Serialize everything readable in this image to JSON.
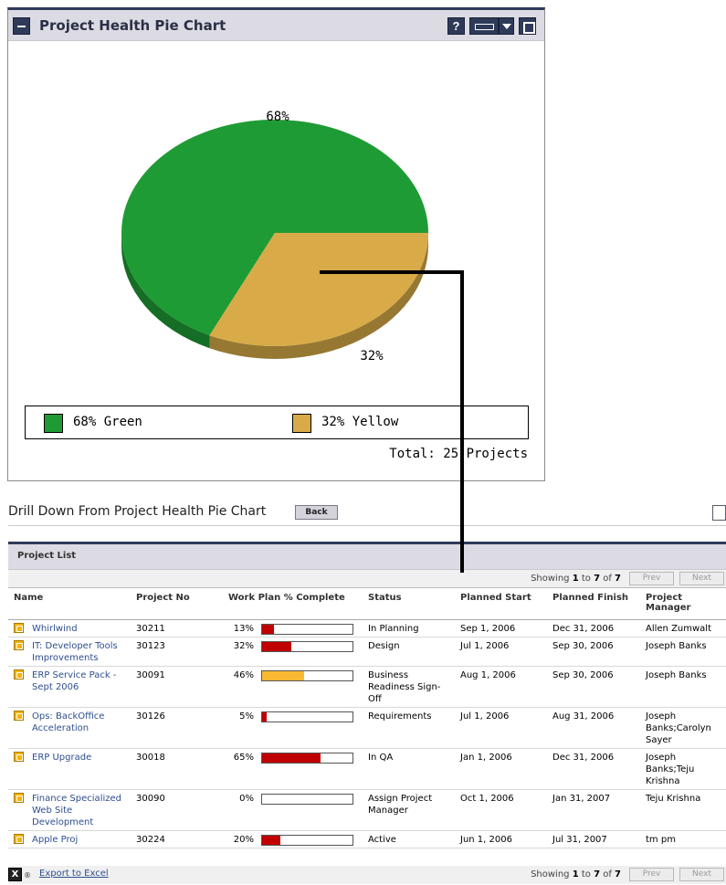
{
  "portlet": {
    "title": "Project Health Pie Chart",
    "help_label": "?"
  },
  "chart_data": {
    "type": "pie",
    "slices": [
      {
        "name": "Green",
        "value": 68,
        "label": "68%",
        "legend": "68% Green",
        "color": "#1f9b35"
      },
      {
        "name": "Yellow",
        "value": 32,
        "label": "32%",
        "legend": "32% Yellow",
        "color": "#d8ab48"
      }
    ],
    "total_text": "Total: 25 Projects"
  },
  "drill": {
    "title": "Drill Down From Project Health Pie Chart",
    "back_label": "Back"
  },
  "list": {
    "title": "Project List",
    "showing_prefix": "Showing ",
    "showing_from": "1",
    "showing_to_word": " to ",
    "showing_to": "7",
    "showing_of_word": " of ",
    "showing_total": "7",
    "prev_label": "Prev",
    "next_label": "Next",
    "export_label": "Export to Excel",
    "columns": [
      "Name",
      "Project No",
      "Work Plan % Complete",
      "Status",
      "Planned Start",
      "Planned Finish",
      "Project Manager"
    ],
    "rows": [
      {
        "name": "Whirlwind",
        "no": "30211",
        "pct": "13%",
        "pct_value": 13,
        "bar_color": "#c00000",
        "status": "In Planning",
        "start": "Sep 1, 2006",
        "finish": "Dec 31, 2006",
        "manager": "Allen Zumwalt"
      },
      {
        "name": "IT: Developer Tools Improvements",
        "no": "30123",
        "pct": "32%",
        "pct_value": 32,
        "bar_color": "#c00000",
        "status": "Design",
        "start": "Jul 1, 2006",
        "finish": "Sep 30, 2006",
        "manager": "Joseph Banks"
      },
      {
        "name": "ERP Service Pack - Sept 2006",
        "no": "30091",
        "pct": "46%",
        "pct_value": 46,
        "bar_color": "#f9b932",
        "status": "Business Readiness Sign-Off",
        "start": "Aug 1, 2006",
        "finish": "Sep 30, 2006",
        "manager": "Joseph Banks"
      },
      {
        "name": "Ops: BackOffice Acceleration",
        "no": "30126",
        "pct": "5%",
        "pct_value": 5,
        "bar_color": "#c00000",
        "status": "Requirements",
        "start": "Jul 1, 2006",
        "finish": "Aug 31, 2006",
        "manager": "Joseph Banks;Carolyn Sayer"
      },
      {
        "name": "ERP Upgrade",
        "no": "30018",
        "pct": "65%",
        "pct_value": 65,
        "bar_color": "#c00000",
        "status": "In QA",
        "start": "Jan 1, 2006",
        "finish": "Dec 31, 2006",
        "manager": "Joseph Banks;Teju Krishna"
      },
      {
        "name": "Finance Specialized Web Site Development",
        "no": "30090",
        "pct": "0%",
        "pct_value": 0,
        "bar_color": "#c00000",
        "status": "Assign Project Manager",
        "start": "Oct 1, 2006",
        "finish": "Jan 31, 2007",
        "manager": "Teju Krishna"
      },
      {
        "name": "Apple Proj",
        "no": "30224",
        "pct": "20%",
        "pct_value": 20,
        "bar_color": "#c00000",
        "status": "Active",
        "start": "Jun 1, 2006",
        "finish": "Jul 31, 2007",
        "manager": "tm pm"
      }
    ]
  }
}
